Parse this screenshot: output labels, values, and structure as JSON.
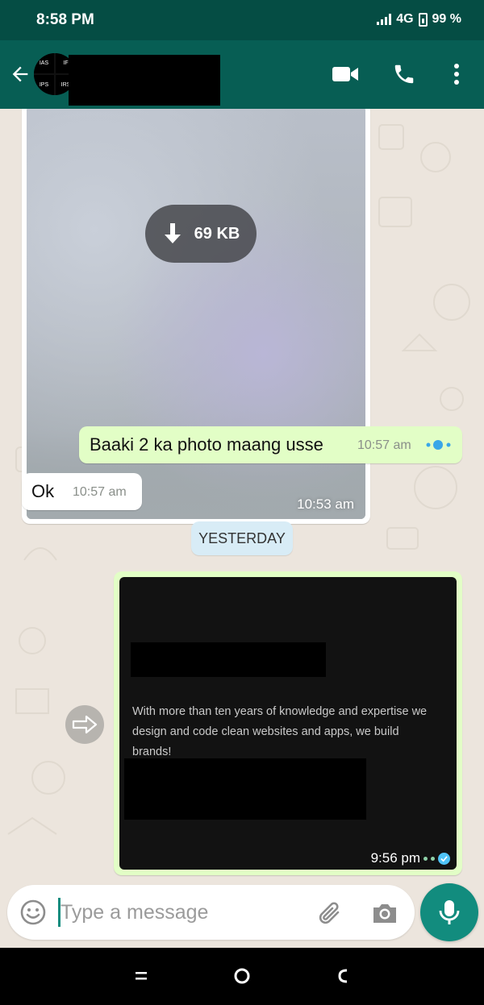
{
  "status_bar": {
    "time": "8:58 PM",
    "network": "4G",
    "battery": "99 %"
  },
  "app_bar": {
    "avatar_tiles": [
      "IAS",
      "IF",
      "IPS",
      "IRS"
    ],
    "contact_name_redacted": true
  },
  "chat": {
    "image_message": {
      "size_label": "69 KB",
      "time": "10:53 am"
    },
    "outgoing_text": {
      "text": "Baaki 2 ka photo maang usse",
      "time": "10:57 am"
    },
    "incoming_text": {
      "text": "Ok",
      "time": "10:57 am"
    },
    "day_divider": "YESTERDAY",
    "link_message": {
      "description": "With more than ten years of knowledge and expertise we design and code clean websites and apps, we build brands!",
      "time": "9:56 pm"
    }
  },
  "composer": {
    "placeholder": "Type a message"
  },
  "colors": {
    "header": "#075e54",
    "status_bar": "#054d44",
    "outgoing_bubble": "#e2fec6",
    "accent": "#128c7e",
    "read_tick": "#4fc3f7"
  },
  "icons": {
    "back": "arrow-left-icon",
    "video": "video-camera-icon",
    "call": "phone-icon",
    "menu": "more-vert-icon",
    "download": "download-arrow-icon",
    "forward": "forward-arrow-icon",
    "emoji": "emoji-icon",
    "attach": "paperclip-icon",
    "camera": "camera-icon",
    "mic": "microphone-icon"
  }
}
